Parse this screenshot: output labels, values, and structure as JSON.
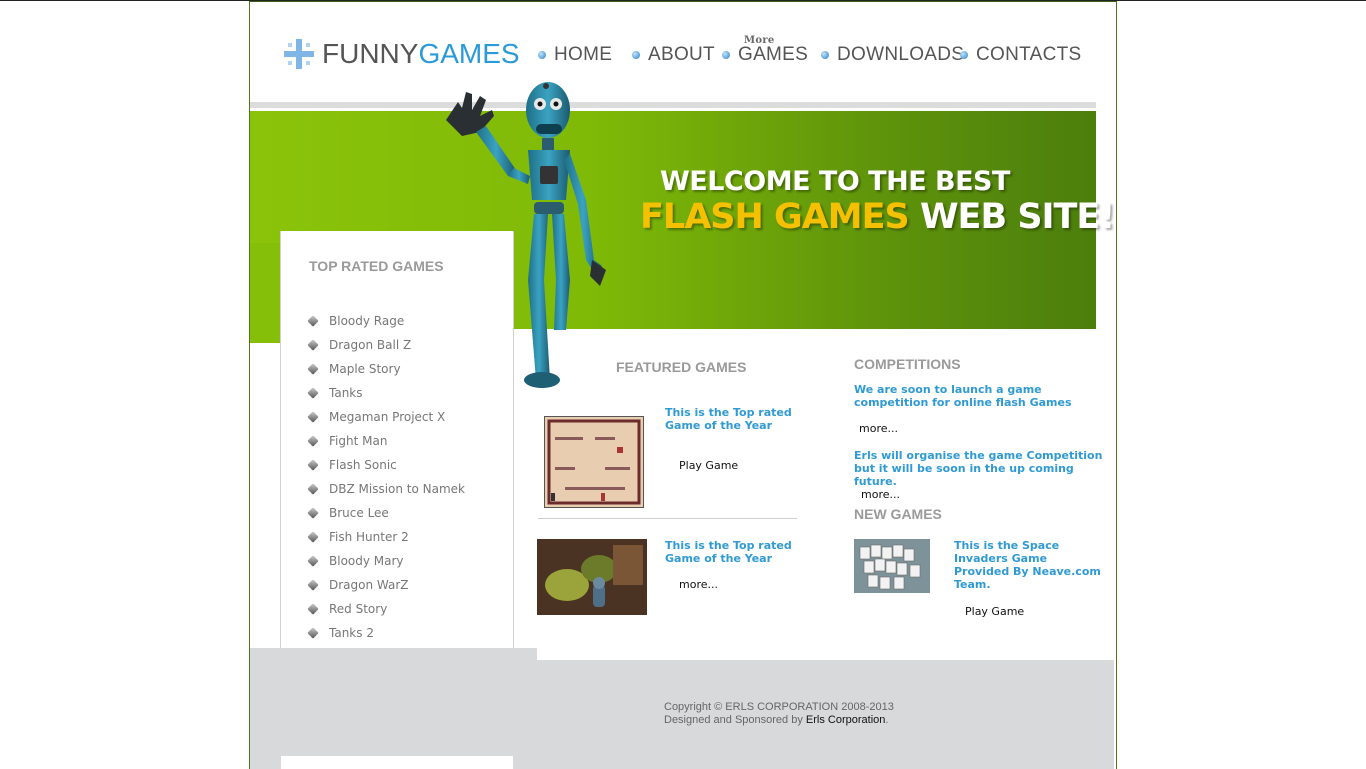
{
  "logo": {
    "funny": "FUNNY",
    "games": "GAMES"
  },
  "nav": {
    "items": [
      {
        "label": "HOME"
      },
      {
        "label": "ABOUT"
      },
      {
        "label": "GAMES",
        "sup": "More"
      },
      {
        "label": "DOWNLOADS"
      },
      {
        "label": "CONTACTS"
      }
    ]
  },
  "banner": {
    "line1": "WELCOME TO THE BEST",
    "line2_highlight": "FLASH GAMES",
    "line2_rest": "WEB SITE!"
  },
  "sidebar": {
    "title": "TOP RATED GAMES",
    "items": [
      "Bloody Rage",
      "Dragon Ball Z",
      "Maple Story",
      "Tanks",
      "Megaman Project X",
      "Fight Man",
      "Flash Sonic",
      "DBZ Mission to Namek",
      "Bruce Lee",
      "Fish Hunter 2",
      "Bloody Mary",
      "Dragon WarZ",
      "Red Story",
      "Tanks 2"
    ]
  },
  "featured": {
    "title": "FEATURED GAMES",
    "item1": {
      "text": "This is the Top rated Game of the Year",
      "link": "Play Game"
    },
    "item2": {
      "text": "This is the Top rated Game of the Year",
      "link": "more..."
    }
  },
  "competitions": {
    "title": "COMPETITIONS",
    "item1": {
      "text": "We are soon to launch a game competition for online flash Games",
      "link": "more..."
    },
    "item2": {
      "text": "Erls will organise the game Competition but it will be soon in the up coming future.",
      "link": "more..."
    }
  },
  "new_games": {
    "title": "NEW GAMES",
    "text": "This is the Space Invaders Game Provided By Neave.com Team.",
    "link": "Play Game"
  },
  "footer": {
    "line1": "Copyright © ERLS CORPORATION 2008-2013",
    "line2_prefix": "Designed and Sponsored by ",
    "line2_link": "Erls Corporation",
    "line2_suffix": "."
  },
  "colors": {
    "accent_blue": "#2f9ad3",
    "banner_green": "#7fba07",
    "gold": "#f5c000"
  }
}
